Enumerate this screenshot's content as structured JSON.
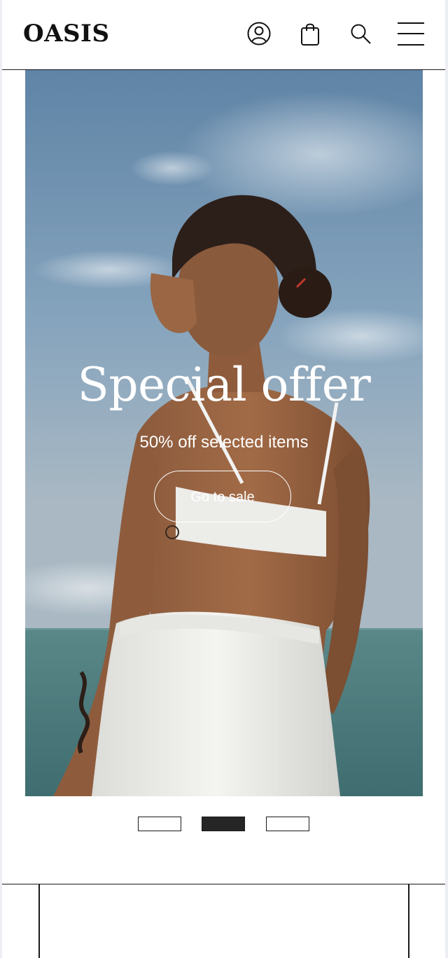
{
  "header": {
    "logo": "OASIS",
    "icons": [
      "account-icon",
      "shopping-bag-icon",
      "search-icon",
      "menu-icon"
    ]
  },
  "hero": {
    "title": "Special offer",
    "subtitle": "50% off selected items",
    "cta_label": "Go to sale"
  },
  "carousel": {
    "slides": 3,
    "active_index": 1
  },
  "colors": {
    "text": "#111111",
    "hero_text": "#ffffff",
    "active_dot": "#262626",
    "page_bg": "#ffffff"
  }
}
